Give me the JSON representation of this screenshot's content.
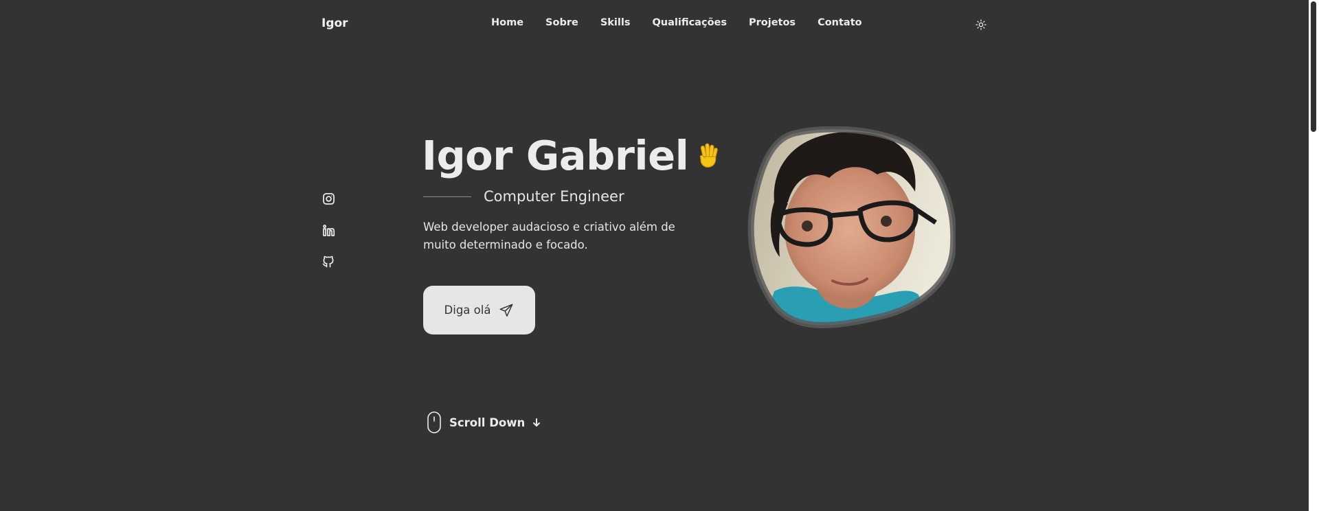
{
  "header": {
    "logo": "Igor",
    "nav": [
      "Home",
      "Sobre",
      "Skills",
      "Qualificações",
      "Projetos",
      "Contato"
    ],
    "theme_toggle_icon": "sun-icon"
  },
  "social": {
    "icons": [
      "instagram-icon",
      "linkedin-icon",
      "github-icon"
    ]
  },
  "hero": {
    "name": "Igor Gabriel",
    "wave_icon": "waving-hand-icon",
    "subtitle": "Computer Engineer",
    "description": "Web developer audacioso e criativo além de muito determinado e focado.",
    "cta_label": "Diga olá",
    "cta_icon": "send-icon"
  },
  "scroll": {
    "label": "Scroll Down",
    "mouse_icon": "mouse-icon",
    "arrow_icon": "arrow-down-icon"
  },
  "colors": {
    "background": "#333333",
    "text": "#ececec",
    "button_bg": "#e6e6e6",
    "wave_accent": "#f5c518"
  }
}
